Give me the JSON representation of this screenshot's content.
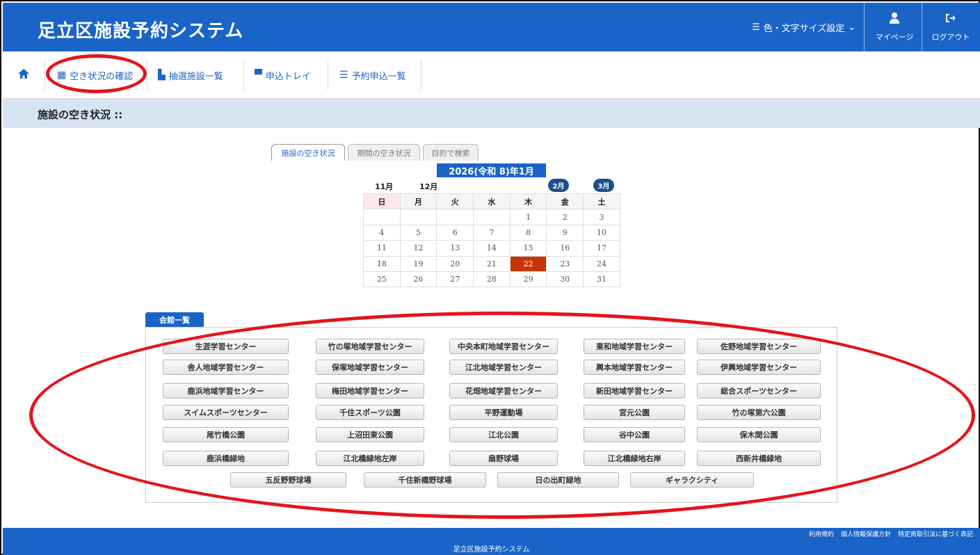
{
  "header": {
    "title": "足立区施設予約システム",
    "settings_label": "色・文字サイズ設定",
    "mypage_label": "マイページ",
    "logout_label": "ログアウト"
  },
  "nav": {
    "items": [
      {
        "label": "空き状況の確認",
        "icon": "calendar-icon"
      },
      {
        "label": "抽選施設一覧",
        "icon": "building-icon"
      },
      {
        "label": "申込トレイ",
        "icon": "cart-icon"
      },
      {
        "label": "予約申込一覧",
        "icon": "list-icon"
      }
    ]
  },
  "page": {
    "heading": "施設の空き状況 ::"
  },
  "tabs": [
    "施設の空き状況",
    "期間の空き状況",
    "目的で検索"
  ],
  "calendar": {
    "title": "2026(令和 8)年1月",
    "prev_months": [
      "11月",
      "12月"
    ],
    "next_months": [
      "2月",
      "3月"
    ],
    "weekdays": [
      "日",
      "月",
      "火",
      "水",
      "木",
      "金",
      "土"
    ],
    "weeks": [
      [
        "",
        "",
        "",
        "",
        "1",
        "2",
        "3"
      ],
      [
        "4",
        "5",
        "6",
        "7",
        "8",
        "9",
        "10"
      ],
      [
        "11",
        "12",
        "13",
        "14",
        "15",
        "16",
        "17"
      ],
      [
        "18",
        "19",
        "20",
        "21",
        "22",
        "23",
        "24"
      ],
      [
        "25",
        "26",
        "27",
        "28",
        "29",
        "30",
        "31"
      ]
    ],
    "today": "22",
    "today_color": "#c5360a"
  },
  "facilities": {
    "label": "会館一覧",
    "rows": [
      [
        "生涯学習センター",
        "竹の塚地域学習センター",
        "中央本町地域学習センター",
        "東和地域学習センター",
        "佐野地域学習センター"
      ],
      [
        "舎人地域学習センター",
        "保塚地域学習センター",
        "江北地域学習センター",
        "興本地域学習センター",
        "伊興地域学習センター"
      ],
      [
        "鹿浜地域学習センター",
        "梅田地域学習センター",
        "花畑地域学習センター",
        "新田地域学習センター",
        "総合スポーツセンター"
      ],
      [
        "スイムスポーツセンター",
        "千住スポーツ公園",
        "平野運動場",
        "宮元公園",
        "竹の塚第六公園"
      ],
      [
        "尾竹橋公園",
        "上沼田東公園",
        "江北公園",
        "谷中公園",
        "保木間公園"
      ],
      [
        "鹿浜橋緑地",
        "江北橋緑地左岸",
        "扇野球場",
        "江北橋緑地右岸",
        "西新井橋緑地"
      ],
      [
        "五反野野球場",
        "千住新橋野球場",
        "日の出町緑地",
        "ギャラクシティ"
      ]
    ]
  },
  "footer": {
    "links": [
      "利用規約",
      "個人情報保護方針",
      "特定商取引法に基づく表記"
    ],
    "copyright": "足立区施設予約システム"
  },
  "colors": {
    "brand": "#1a64c8",
    "annotation": "#e5141b"
  }
}
